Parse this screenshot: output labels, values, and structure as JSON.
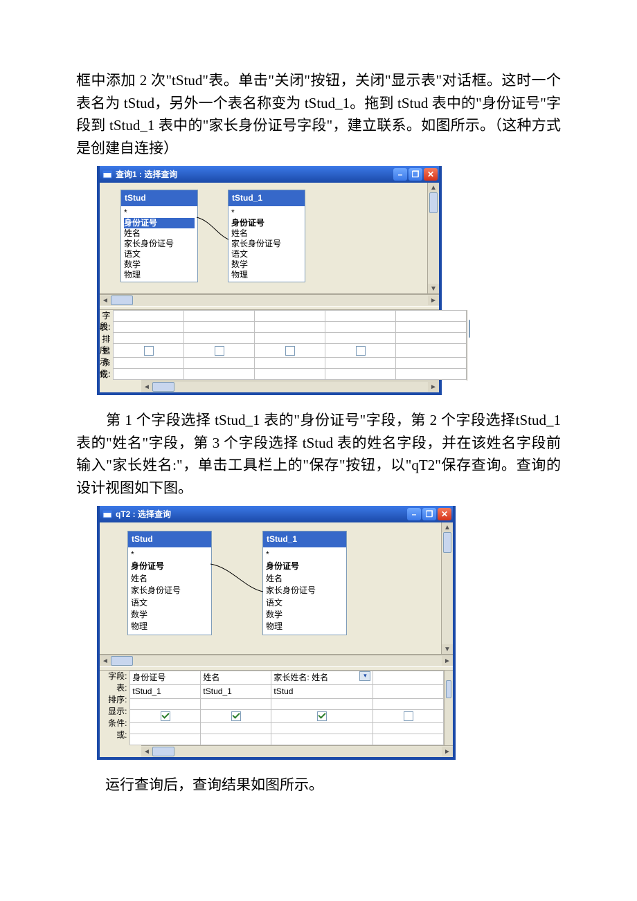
{
  "para1": "框中添加 2 次\"tStud\"表。单击\"关闭\"按钮，关闭\"显示表\"对话框。这时一个表名为 tStud，另外一个表名称变为 tStud_1。拖到 tStud 表中的\"身份证号\"字段到 tStud_1 表中的\"家长身份证号字段\"，建立联系。如图所示。（这种方式是创建自连接）",
  "para2_indent": "第 1 个字段选择 tStud_1 表的\"身份证号\"字段，第 2 个字段选择",
  "para2_rest": "tStud_1 表的\"姓名\"字段，第 3 个字段选择 tStud 表的姓名字段，并在该姓名字段前输入\"家长姓名:\"，单击工具栏上的\"保存\"按钮，以\"qT2\"保存查询。查询的设计视图如下图。",
  "para3": "运行查询后，查询结果如图所示。",
  "window1": {
    "title": "查询1  :  选择查询",
    "tables": {
      "left": {
        "name": "tStud",
        "fields": [
          "*",
          "身份证号",
          "姓名",
          "家长身份证号",
          "语文",
          "数学",
          "物理"
        ],
        "selected": "身份证号"
      },
      "right": {
        "name": "tStud_1",
        "fields": [
          "*",
          "身份证号",
          "姓名",
          "家长身份证号",
          "语文",
          "数学",
          "物理"
        ],
        "bold": "身份证号"
      }
    },
    "rowlabels": [
      "字段:",
      "表:",
      "排序:",
      "显示:",
      "条件:",
      "或:"
    ]
  },
  "window2": {
    "title": "qT2  :  选择查询",
    "tables": {
      "left": {
        "name": "tStud",
        "fields": [
          "*",
          "身份证号",
          "姓名",
          "家长身份证号",
          "语文",
          "数学",
          "物理"
        ],
        "bold": "身份证号"
      },
      "right": {
        "name": "tStud_1",
        "fields": [
          "*",
          "身份证号",
          "姓名",
          "家长身份证号",
          "语文",
          "数学",
          "物理"
        ],
        "bold": "身份证号"
      }
    },
    "rowlabels": [
      "字段:",
      "表:",
      "排序:",
      "显示:",
      "条件:",
      "或:"
    ],
    "grid": {
      "fieldRow": [
        "身份证号",
        "姓名",
        "家长姓名: 姓名",
        ""
      ],
      "tableRow": [
        "tStud_1",
        "tStud_1",
        "tStud",
        ""
      ],
      "showRow": [
        true,
        true,
        true,
        false
      ]
    }
  }
}
